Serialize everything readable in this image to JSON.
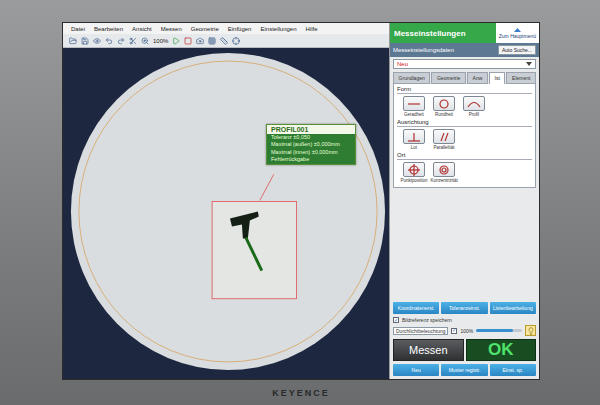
{
  "window": {
    "title": "Messeinstellungen",
    "home_button": "Zum Hauptmenü"
  },
  "menu": [
    "Datei",
    "Bearbeiten",
    "Ansicht",
    "Messen",
    "Geometrie",
    "Einfügen",
    "Einstellungen",
    "Hilfe"
  ],
  "toolbar": {
    "zoom": "100%"
  },
  "overlay": {
    "title": "PROFIL001",
    "lines": [
      "Toleranz ±0,050",
      "Maximal (außen) ±0,000mm",
      "Maximal (innen) ±0,000mm",
      "Fehlerrückgabe"
    ]
  },
  "settings": {
    "label": "Messeinstellungsdaten",
    "auto_button": "Auto Suche...",
    "selection": "Neu"
  },
  "tabs": [
    {
      "label": "Grundlagen",
      "selected": false
    },
    {
      "label": "Geometrie",
      "selected": false
    },
    {
      "label": "Anw",
      "selected": false
    },
    {
      "label": "Ist",
      "selected": true
    },
    {
      "label": "Element",
      "selected": false
    }
  ],
  "sections": [
    {
      "title": "Form",
      "items": [
        {
          "label": "Geradheit",
          "kind": "straightness"
        },
        {
          "label": "Rundheit",
          "kind": "roundness"
        },
        {
          "label": "Profil",
          "kind": "profile"
        }
      ]
    },
    {
      "title": "Ausrichtung",
      "items": [
        {
          "label": "Lot",
          "kind": "perpendicular"
        },
        {
          "label": "Parallelität",
          "kind": "parallel"
        }
      ]
    },
    {
      "title": "Ort",
      "items": [
        {
          "label": "Punktposition",
          "kind": "position"
        },
        {
          "label": "Konzentrizität",
          "kind": "concentric"
        }
      ]
    }
  ],
  "tools": [
    "Koordinatenerst.",
    "Toleranzeinst.",
    "Listenbearbeitung"
  ],
  "options": {
    "checkbox": {
      "label": "Bildreferenz speichern",
      "checked": true
    },
    "lighting": "Durchlichtbeleuchtung",
    "lighting_checked": true,
    "brightness": "100%",
    "level": 0.8
  },
  "measure_button": "Messen",
  "result": "OK",
  "footer_buttons": [
    "Neu",
    "Muster registr.",
    "Einst. sp."
  ],
  "brand": "KEYENCE"
}
